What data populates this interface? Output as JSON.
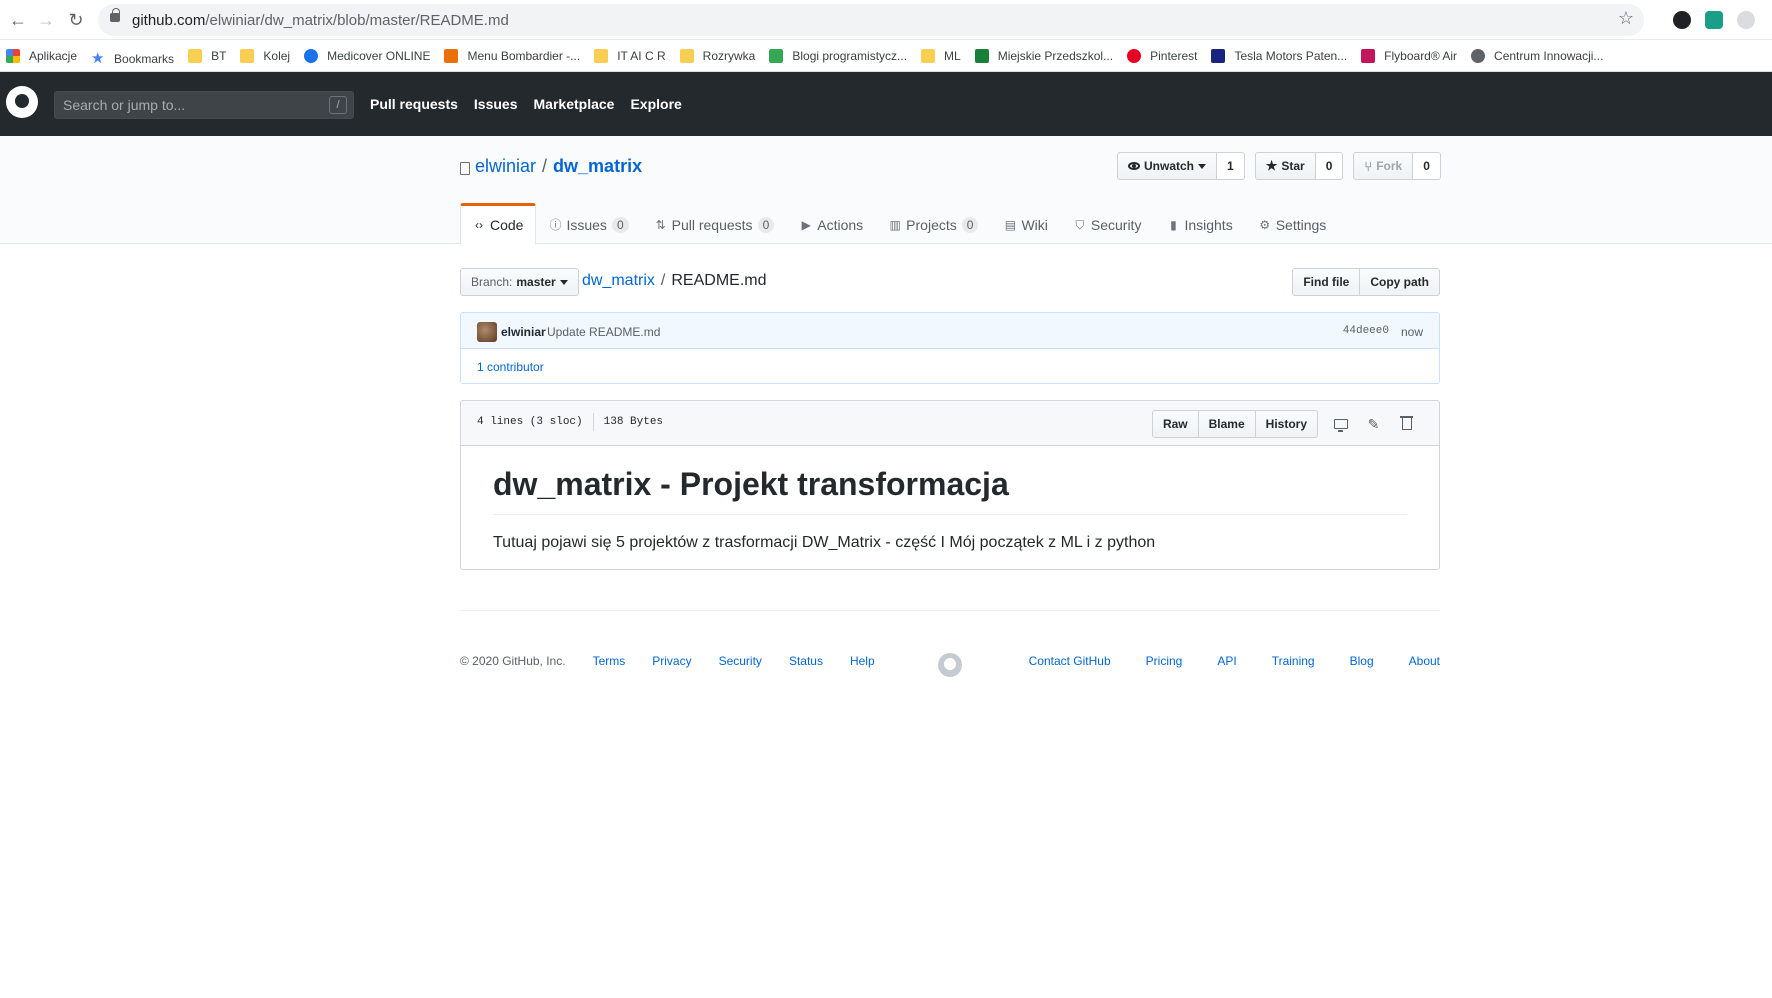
{
  "browser": {
    "url_host": "github.com",
    "url_path": "/elwiniar/dw_matrix/blob/master/README.md",
    "bookmarks": [
      {
        "label": "Aplikacje",
        "icon": "apps-grid-icon"
      },
      {
        "label": "Bookmarks",
        "icon": "star-icon"
      },
      {
        "label": "BT",
        "icon": "folder-icon"
      },
      {
        "label": "Kolej",
        "icon": "folder-icon"
      },
      {
        "label": "Medicover ONLINE",
        "icon": "medicover-icon"
      },
      {
        "label": "Menu Bombardier -...",
        "icon": "bombardier-icon"
      },
      {
        "label": "IT AI C R",
        "icon": "folder-icon"
      },
      {
        "label": "Rozrywka",
        "icon": "folder-icon"
      },
      {
        "label": "Blogi programistycz...",
        "icon": "blog-icon"
      },
      {
        "label": "ML",
        "icon": "folder-icon"
      },
      {
        "label": "Miejskie Przedszkol...",
        "icon": "school-icon"
      },
      {
        "label": "Pinterest",
        "icon": "pinterest-icon"
      },
      {
        "label": "Tesla Motors Paten...",
        "icon": "tesla-icon"
      },
      {
        "label": "Flyboard® Air",
        "icon": "flyboard-icon"
      },
      {
        "label": "Centrum Innowacji...",
        "icon": "globe-icon"
      }
    ]
  },
  "header": {
    "search_placeholder": "Search or jump to...",
    "search_key": "/",
    "nav": [
      "Pull requests",
      "Issues",
      "Marketplace",
      "Explore"
    ]
  },
  "repo": {
    "owner": "elwiniar",
    "separator": "/",
    "name": "dw_matrix",
    "watch_label": "Unwatch",
    "watch_count": "1",
    "star_label": "Star",
    "star_count": "0",
    "fork_label": "Fork",
    "fork_count": "0"
  },
  "tabs": [
    {
      "label": "Code",
      "icon": "code-icon",
      "counter": null,
      "selected": true
    },
    {
      "label": "Issues",
      "icon": "issue-icon",
      "counter": "0"
    },
    {
      "label": "Pull requests",
      "icon": "pull-request-icon",
      "counter": "0"
    },
    {
      "label": "Actions",
      "icon": "play-icon",
      "counter": null
    },
    {
      "label": "Projects",
      "icon": "project-icon",
      "counter": "0"
    },
    {
      "label": "Wiki",
      "icon": "book-icon",
      "counter": null
    },
    {
      "label": "Security",
      "icon": "shield-icon",
      "counter": null
    },
    {
      "label": "Insights",
      "icon": "graph-icon",
      "counter": null
    },
    {
      "label": "Settings",
      "icon": "gear-icon",
      "counter": null
    }
  ],
  "file_nav": {
    "branch_label": "Branch:",
    "branch_value": "master",
    "crumb_repo": "dw_matrix",
    "crumb_sep": "/",
    "crumb_file": "README.md",
    "find_file": "Find file",
    "copy_path": "Copy path"
  },
  "commit": {
    "author": "elwiniar",
    "message": "Update README.md",
    "sha": "44deee0",
    "time": "now",
    "contributors": "1 contributor"
  },
  "file": {
    "lines": "4 lines (3 sloc)",
    "size": "138 Bytes",
    "raw": "Raw",
    "blame": "Blame",
    "history": "History",
    "heading": "dw_matrix - Projekt transformacja",
    "paragraph": "Tutuaj pojawi się 5 projektów z trasformacji DW_Matrix - część I Mój początek z ML i z python"
  },
  "footer": {
    "copyright": "© 2020 GitHub, Inc.",
    "left_links": [
      "Terms",
      "Privacy",
      "Security",
      "Status",
      "Help"
    ],
    "right_links": [
      "Contact GitHub",
      "Pricing",
      "API",
      "Training",
      "Blog",
      "About"
    ]
  },
  "colors": {
    "header_bg": "#24292e",
    "link": "#0366d6",
    "tab_accent": "#e36209",
    "commit_bg": "#f1f8ff"
  }
}
